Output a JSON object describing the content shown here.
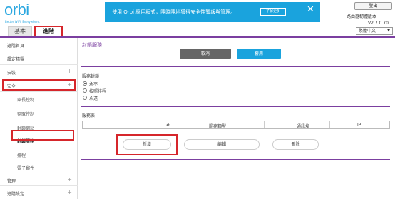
{
  "logo": {
    "text": "orbi",
    "tagline": "Better WiFi. Everywhere."
  },
  "nav": {
    "tab_basic": "基本",
    "tab_advanced": "進階"
  },
  "banner": {
    "text": "使用 Orbi 應用程式，隨時隨地獲得安全性警報與管理。",
    "more": "了解更多",
    "close": "✕"
  },
  "top_right": {
    "logout": "登出",
    "router_label": "路由器韌體版本",
    "version": "V2.7.0.70",
    "language": "繁體中文"
  },
  "sidebar": {
    "items": [
      {
        "label": "進階首頁",
        "has_plus": false
      },
      {
        "label": "設定精靈",
        "has_plus": false
      },
      {
        "label": "安裝",
        "has_plus": true
      },
      {
        "label": "安全",
        "has_plus": true
      },
      {
        "label": "管理",
        "has_plus": true
      },
      {
        "label": "進階設定",
        "has_plus": true
      }
    ],
    "subitems": [
      {
        "label": "家長控制"
      },
      {
        "label": "存取控制"
      },
      {
        "label": "封鎖網站"
      },
      {
        "label": "封鎖服務"
      },
      {
        "label": "排程"
      },
      {
        "label": "電子郵件"
      }
    ],
    "plus_glyph": "+"
  },
  "main": {
    "title": "封鎖服務",
    "cancel": "取消",
    "apply": "套用",
    "schedule_title": "服務封鎖",
    "options": [
      {
        "label": "永不",
        "selected": true
      },
      {
        "label": "按照排程",
        "selected": false
      },
      {
        "label": "永遠",
        "selected": false
      }
    ],
    "services_title": "服務表",
    "columns": [
      "#",
      "服務類型",
      "通訊埠",
      "IP"
    ],
    "buttons": {
      "add": "新增",
      "edit": "編輯",
      "delete": "刪除"
    }
  }
}
